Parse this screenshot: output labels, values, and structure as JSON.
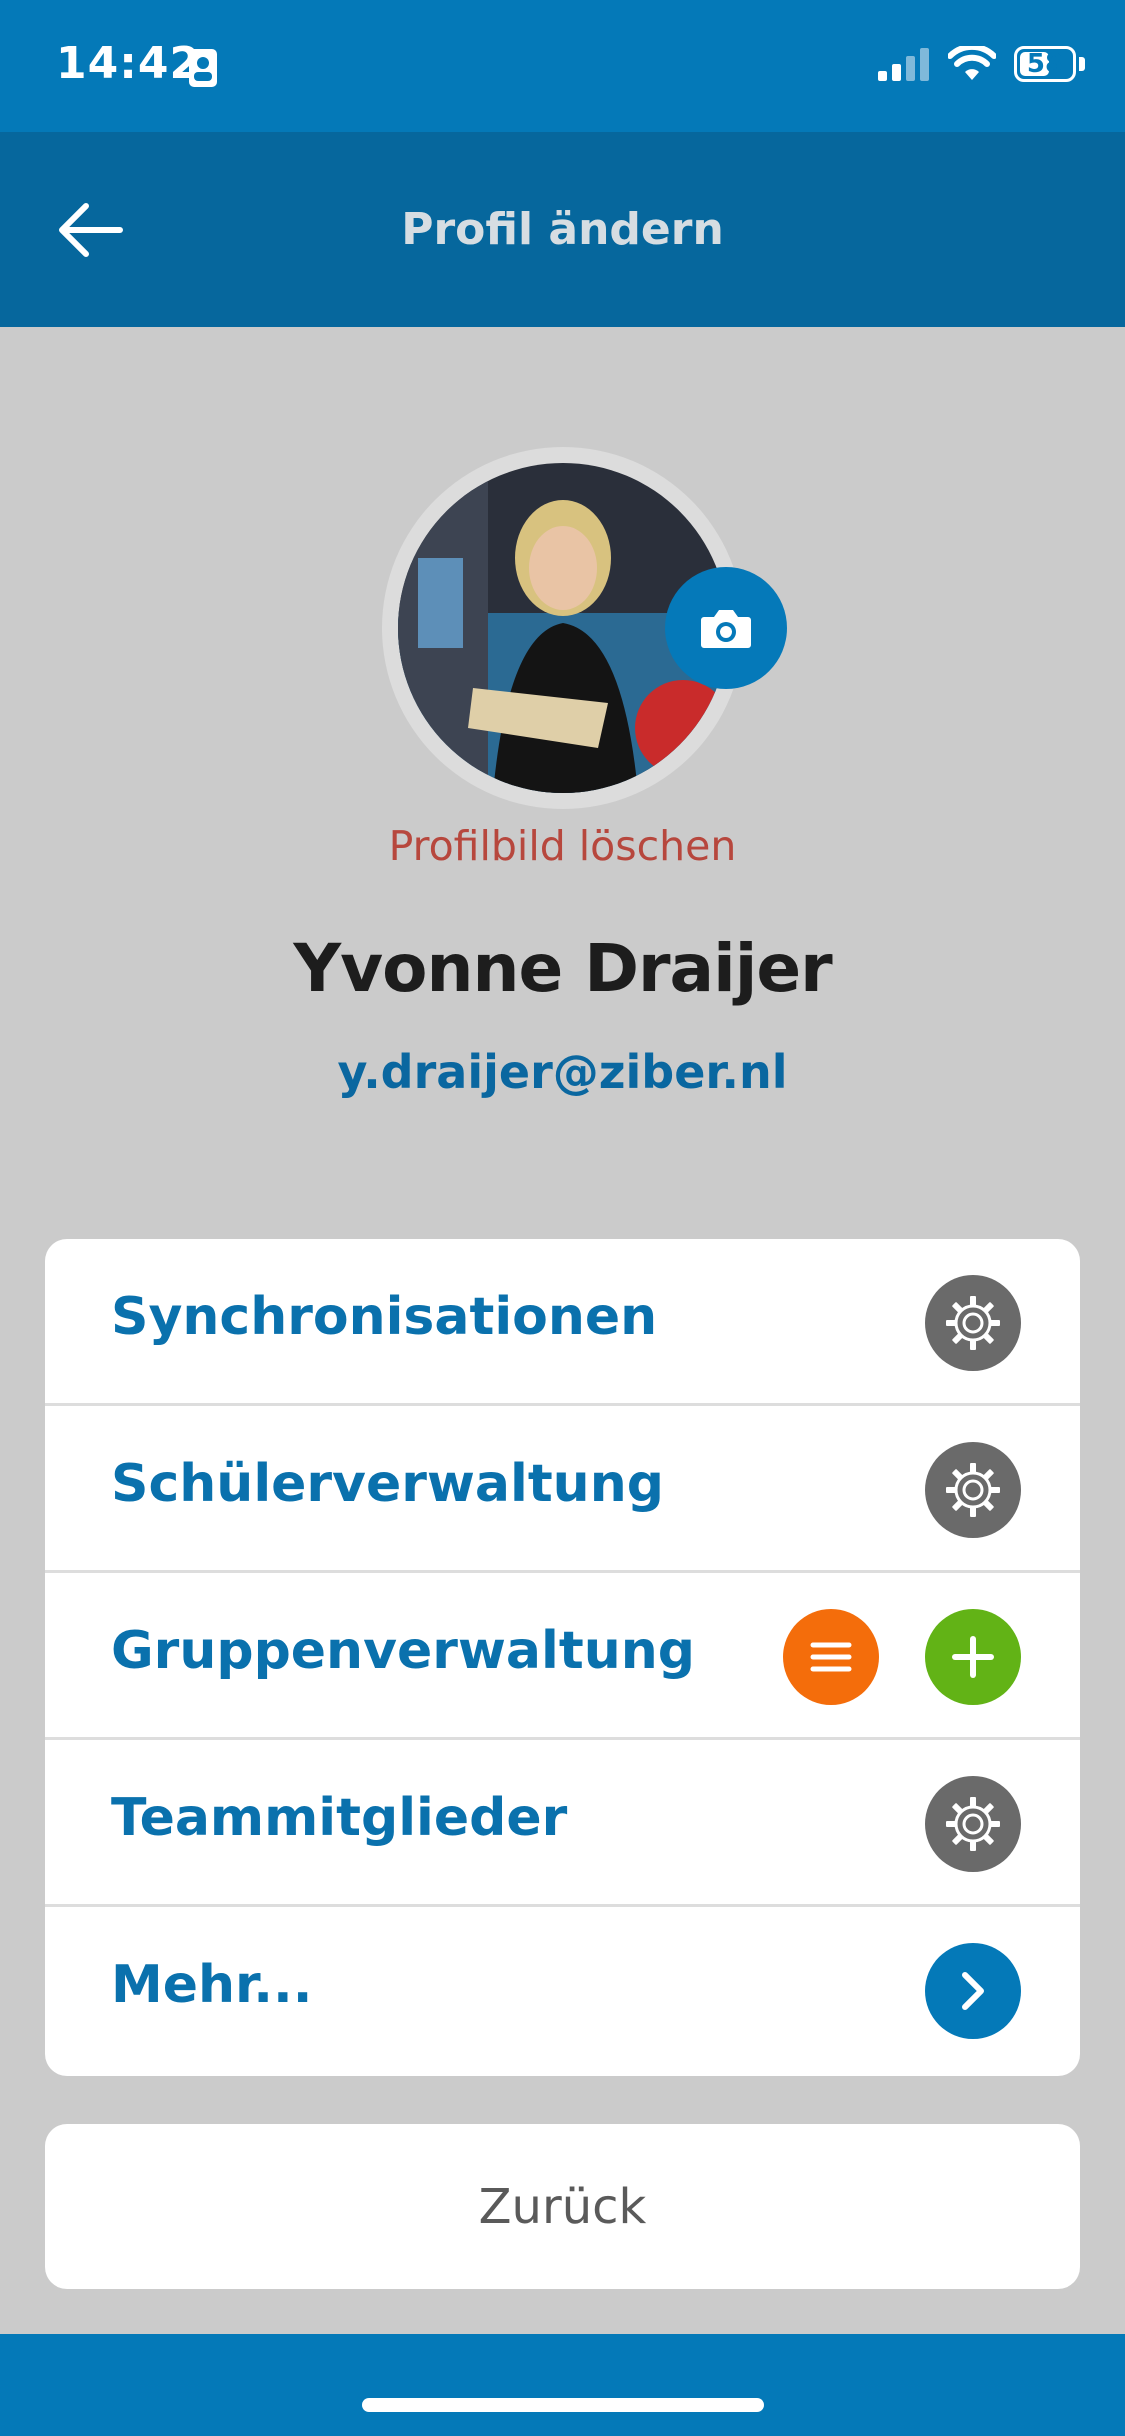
{
  "status_bar": {
    "time": "14:42",
    "battery": "58",
    "battery_level": 0.58,
    "icons": [
      "contact-card-icon",
      "cellular-signal-icon",
      "wifi-icon",
      "battery-icon"
    ]
  },
  "header": {
    "title": "Profil ändern",
    "back_icon": "arrow-left-icon"
  },
  "profile": {
    "delete_photo_label": "Profilbild löschen",
    "name": "Yvonne Draijer",
    "email": "y.draijer@ziber.nl",
    "camera_icon": "camera-icon"
  },
  "menu": {
    "items": [
      {
        "label": "Synchronisationen",
        "actions": [
          "gear-icon"
        ]
      },
      {
        "label": "Schülerverwaltung",
        "actions": [
          "gear-icon"
        ]
      },
      {
        "label": "Gruppenverwaltung",
        "actions": [
          "list-icon",
          "plus-icon"
        ]
      },
      {
        "label": "Teammitglieder",
        "actions": [
          "gear-icon"
        ]
      },
      {
        "label": "Mehr...",
        "actions": [
          "chevron-right-icon"
        ]
      }
    ]
  },
  "footer": {
    "back_button_label": "Zurück"
  },
  "colors": {
    "primary_blue": "#0479b8",
    "header_blue": "#06679d",
    "delete_red": "#b7473d",
    "gear_gray": "#6a6a6a",
    "orange": "#f46d0b",
    "green": "#62b316",
    "background": "#cbcbcb"
  }
}
